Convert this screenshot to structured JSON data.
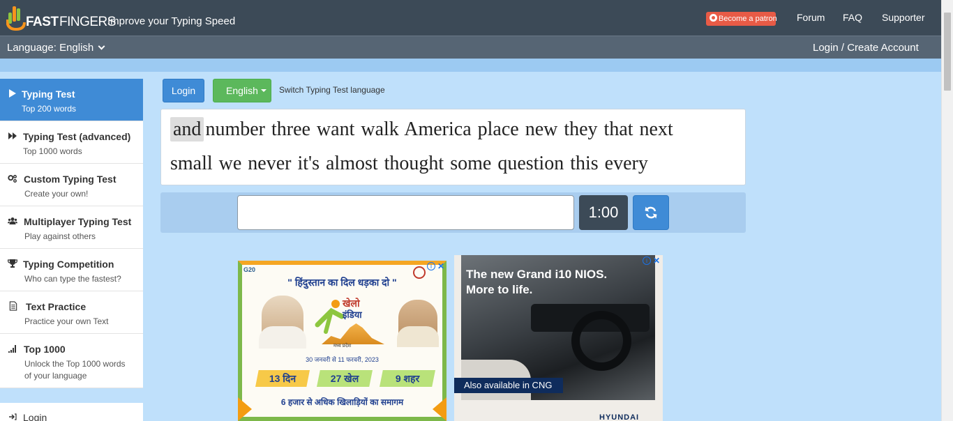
{
  "header": {
    "logo_fast": "FAST",
    "logo_fingers": "FINGERS",
    "tagline": "Improve your Typing Speed",
    "patron_label": "Become a patron",
    "nav": [
      "Forum",
      "FAQ",
      "Supporter"
    ]
  },
  "subbar": {
    "language_label": "Language: English",
    "login_create": "Login / Create Account"
  },
  "sidebar": {
    "items": [
      {
        "title": "Typing Test",
        "sub": "Top 200 words",
        "icon": "play-icon",
        "active": true
      },
      {
        "title": "Typing Test (advanced)",
        "sub": "Top 1000 words",
        "icon": "fast-forward-icon"
      },
      {
        "title": "Custom Typing Test",
        "sub": "Create your own!",
        "icon": "gears-icon"
      },
      {
        "title": "Multiplayer Typing Test",
        "sub": "Play against others",
        "icon": "users-icon"
      },
      {
        "title": "Typing Competition",
        "sub": "Who can type the fastest?",
        "icon": "trophy-icon"
      },
      {
        "title": "Text Practice",
        "sub": "Practice your own Text",
        "icon": "document-icon"
      },
      {
        "title": "Top 1000",
        "sub": "Unlock the Top 1000 words of your language",
        "sub_line1": "Unlock the Top 1000 words",
        "sub_line2": "of your language",
        "icon": "signal-bars-icon"
      }
    ],
    "login_label": "Login"
  },
  "test": {
    "login_button": "Login",
    "language_button": "English",
    "switch_language": "Switch Typing Test language",
    "current_word": "and",
    "line1_rest": "number three want walk America place new they that next",
    "line2": "small we never it's almost thought some question this every",
    "input_value": "",
    "timer": "1:00",
    "reload_icon": "refresh-icon"
  },
  "ads": {
    "ad1": {
      "logo_left": "G20",
      "headline": "\" हिंदुस्तान का दिल धड़का दो \"",
      "khelo_line1": "खेलो",
      "khelo_line2": "इंडिया",
      "region": "मध्य प्रदेश",
      "date": "30 जनवरी से 11 फरवरी, 2023",
      "pills": [
        "13 दिन",
        "27 खेल",
        "9 शहर"
      ],
      "footer": "6 हजार से अधिक खिलाड़ियों का समागम"
    },
    "ad2": {
      "title_line1": "The new Grand i10 NIOS.",
      "title_line2": "More to life.",
      "cng": "Also available in CNG",
      "brand": "HYUNDAI"
    },
    "close_glyph": "✕",
    "info_glyph": "i"
  },
  "colors": {
    "header_bg": "#3c4a57",
    "subbar_bg": "#566574",
    "page_bg": "#bfe0fb",
    "active_blue": "#3f8bd6",
    "green": "#5cb85c",
    "patron": "#e85b46"
  }
}
